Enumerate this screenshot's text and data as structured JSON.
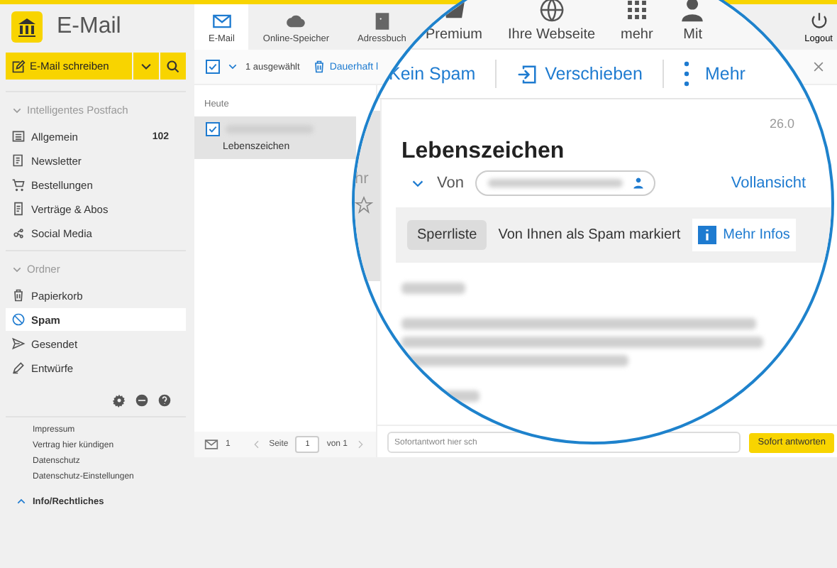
{
  "app": {
    "title": "E-Mail"
  },
  "nav": [
    {
      "label": "E-Mail",
      "selected": true,
      "kind": "mail"
    },
    {
      "label": "Online-Speicher",
      "selected": false,
      "kind": "cloud"
    },
    {
      "label": "Adressbuch",
      "selected": false,
      "kind": "contacts"
    }
  ],
  "logout": {
    "label": "Logout"
  },
  "compose": {
    "label": "E-Mail schreiben"
  },
  "sidebar": {
    "sections": [
      {
        "title": "Intelligentes Postfach",
        "expanded": true,
        "items": [
          {
            "label": "Allgemein",
            "count": "102",
            "selected": false,
            "kind": "list"
          },
          {
            "label": "Newsletter",
            "selected": false,
            "kind": "news"
          },
          {
            "label": "Bestellungen",
            "selected": false,
            "kind": "cart"
          },
          {
            "label": "Verträge & Abos",
            "selected": false,
            "kind": "doc"
          },
          {
            "label": "Social Media",
            "selected": false,
            "kind": "social"
          }
        ]
      },
      {
        "title": "Ordner",
        "expanded": true,
        "items": [
          {
            "label": "Papierkorb",
            "selected": false,
            "kind": "trash"
          },
          {
            "label": "Spam",
            "selected": true,
            "kind": "spam"
          },
          {
            "label": "Gesendet",
            "selected": false,
            "kind": "send"
          },
          {
            "label": "Entwürfe",
            "selected": false,
            "kind": "pen"
          }
        ]
      }
    ]
  },
  "footer_links": [
    "Impressum",
    "Vertrag hier kündigen",
    "Datenschutz",
    "Datenschutz-Einstellungen"
  ],
  "info_section": {
    "label": "Info/Rechtliches",
    "expanded": true
  },
  "list_toolbar": {
    "checked": true,
    "selection": "1 ausgewählt",
    "action": "Dauerhaft l"
  },
  "message_list": {
    "group": "Heute",
    "items": [
      {
        "subject": "Lebenszeichen",
        "checked": true,
        "selected": true
      }
    ]
  },
  "list_footer": {
    "count": "1",
    "page_label": "Seite",
    "page": "1",
    "of": "von 1"
  },
  "magnifier": {
    "nav": [
      {
        "label": "Premium",
        "kind": "premium"
      },
      {
        "label": "Ihre Webseite",
        "kind": "globe"
      },
      {
        "label": "mehr",
        "kind": "grid"
      },
      {
        "label": "Mit",
        "kind": "person"
      }
    ],
    "toolbar": [
      {
        "label": "Kein Spam",
        "kind": "plain"
      },
      {
        "label": "Verschieben",
        "kind": "move"
      },
      {
        "label": "Mehr",
        "kind": "more"
      }
    ],
    "list_fragment": "hr",
    "date": "26.0",
    "subject": "Lebenszeichen",
    "from_label": "Von",
    "full_view": "Vollansicht",
    "spam_bar": {
      "button": "Sperrliste",
      "message": "Von Ihnen als Spam markiert",
      "link": "Mehr Infos"
    }
  },
  "reply": {
    "placeholder": "Sofortantwort hier sch",
    "button": "Sofort antworten"
  }
}
